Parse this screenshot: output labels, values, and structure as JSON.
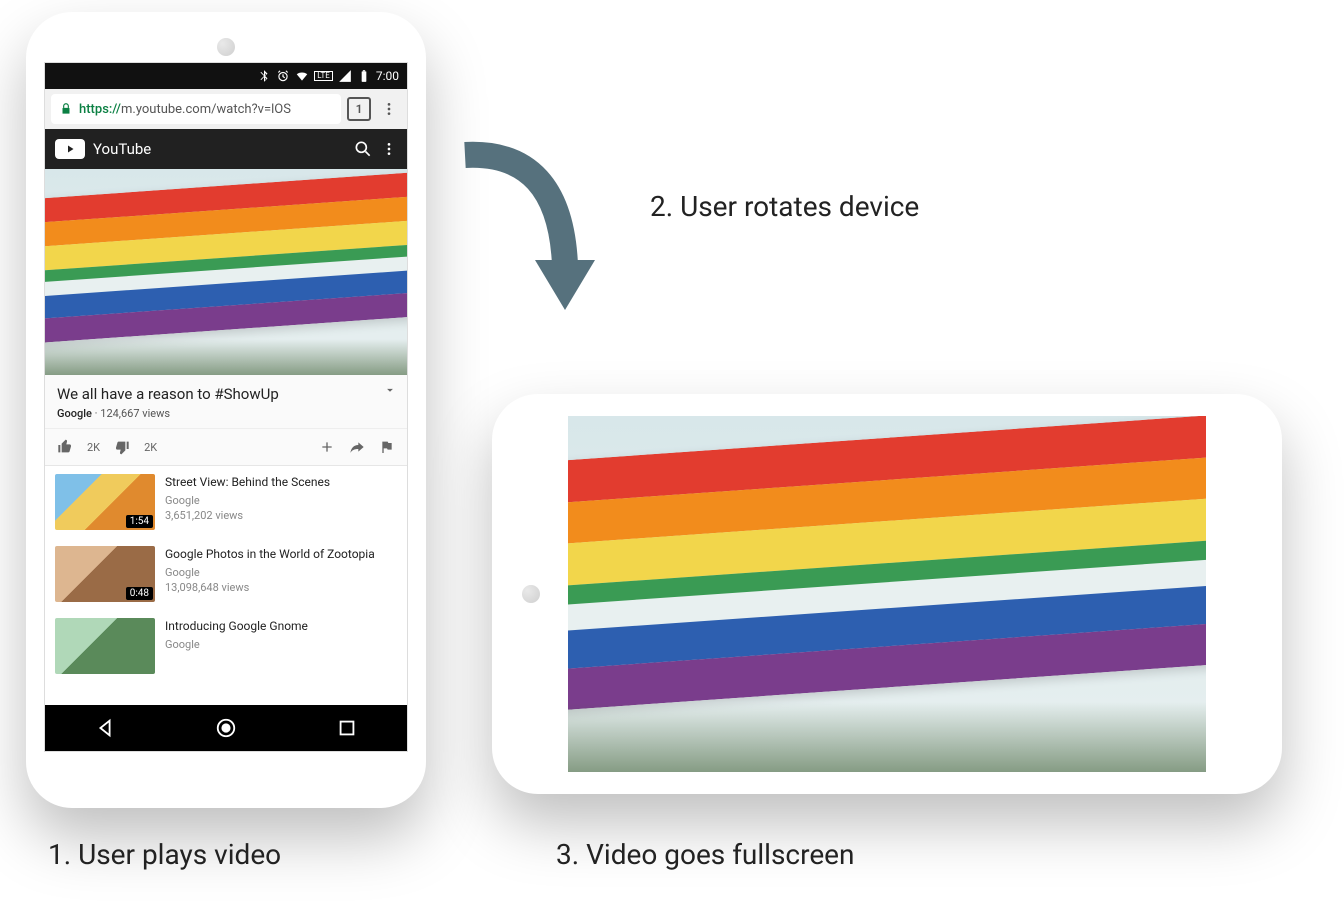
{
  "captions": {
    "step1": "1. User plays video",
    "step2": "2. User rotates device",
    "step3": "3. Video goes fullscreen"
  },
  "status": {
    "time": "7:00",
    "signal_label": "LTE"
  },
  "urlbar": {
    "scheme": "https://",
    "rest": "m.youtube.com/watch?v=lOS",
    "tab_count": "1"
  },
  "yt_header": {
    "title": "YouTube"
  },
  "video": {
    "title": "We all have a reason to #ShowUp",
    "channel": "Google",
    "views": "124,667 views",
    "likes": "2K",
    "dislikes": "2K"
  },
  "related": [
    {
      "title": "Street View: Behind the Scenes",
      "channel": "Google",
      "views": "3,651,202 views",
      "duration": "1:54"
    },
    {
      "title": "Google Photos in the World of Zootopia",
      "channel": "Google",
      "views": "13,098,648 views",
      "duration": "0:48"
    },
    {
      "title": "Introducing Google Gnome",
      "channel": "Google",
      "views": "",
      "duration": ""
    }
  ]
}
